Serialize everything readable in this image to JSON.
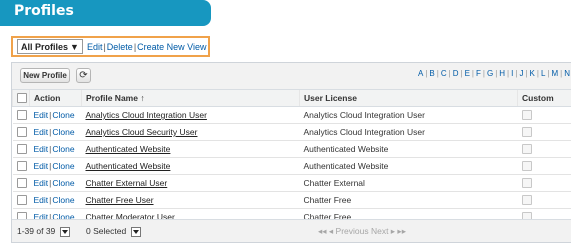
{
  "header": {
    "title": "Profiles"
  },
  "view_selector": {
    "selected": "All Profiles",
    "links": [
      "Edit",
      "Delete",
      "Create New View"
    ]
  },
  "toolbar": {
    "new_label": "New Profile",
    "refresh_icon": "refresh-icon",
    "alphabet": [
      "A",
      "B",
      "C",
      "D",
      "E",
      "F",
      "G",
      "H",
      "I",
      "J",
      "K",
      "L",
      "M",
      "N"
    ]
  },
  "table": {
    "headers": {
      "action": "Action",
      "profile_name": "Profile Name ↑",
      "user_license": "User License",
      "custom": "Custom"
    },
    "rows": [
      {
        "edit": "Edit",
        "clone": "Clone",
        "name": "Analytics Cloud Integration User",
        "license": "Analytics Cloud Integration User"
      },
      {
        "edit": "Edit",
        "clone": "Clone",
        "name": "Analytics Cloud Security User",
        "license": "Analytics Cloud Integration User"
      },
      {
        "edit": "Edit",
        "clone": "Clone",
        "name": "Authenticated Website",
        "license": "Authenticated Website"
      },
      {
        "edit": "Edit",
        "clone": "Clone",
        "name": "Authenticated Website",
        "license": "Authenticated Website"
      },
      {
        "edit": "Edit",
        "clone": "Clone",
        "name": "Chatter External User",
        "license": "Chatter External"
      },
      {
        "edit": "Edit",
        "clone": "Clone",
        "name": "Chatter Free User",
        "license": "Chatter Free"
      },
      {
        "edit": "Edit",
        "clone": "Clone",
        "name": "Chatter Moderator User",
        "license": "Chatter Free"
      }
    ]
  },
  "footer": {
    "range": "1-39 of 39",
    "selected": "0 Selected",
    "pager": "◂◂ ◂ Previous  Next ▸ ▸▸"
  },
  "colors": {
    "header_bg": "#1797c0",
    "highlight_border": "#f0a24a",
    "link": "#015ba7"
  }
}
